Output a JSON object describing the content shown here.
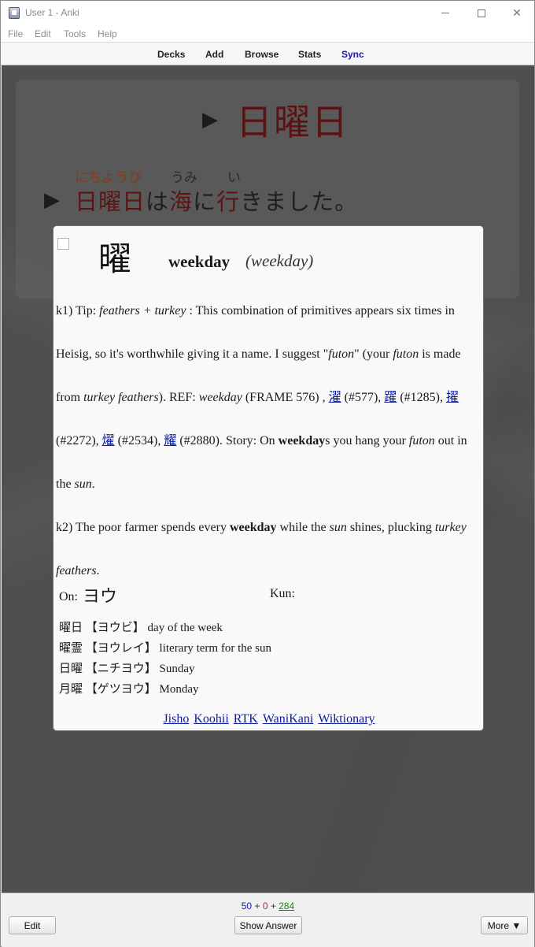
{
  "window": {
    "title": "User 1 - Anki"
  },
  "menu": {
    "items": [
      "File",
      "Edit",
      "Tools",
      "Help"
    ]
  },
  "toolbar": {
    "decks": "Decks",
    "add": "Add",
    "browse": "Browse",
    "stats": "Stats",
    "sync": "Sync"
  },
  "card": {
    "play_icon": "▶",
    "front_word": "日曜日",
    "sentence": {
      "furigana": [
        "にちようび",
        "うみ",
        "い"
      ],
      "parts": [
        "日曜日",
        "は",
        "海",
        "に",
        "行",
        "きました。"
      ]
    }
  },
  "popup": {
    "kanji": "曜",
    "keyword": "weekday",
    "keyword_alt": "(weekday)",
    "story": {
      "k1_label": "k1) Tip: ",
      "k1_prim": "feathers + turkey",
      "k1_t1": " : This combination of primitives appears six times in Heisig, so it's worthwhile giving it a name. I suggest \"",
      "k1_futon": "futon",
      "k1_t2": "\" (your ",
      "k1_futon2": "futon",
      "k1_t3": " is made from ",
      "k1_tf": "turkey feathers",
      "k1_t4": "). REF: ",
      "k1_ref": "weekday",
      "k1_t5": " (FRAME 576) , ",
      "k1_r1k": "濯",
      "k1_r1n": " (#577), ",
      "k1_r2k": "躍",
      "k1_r2n": " (#1285), ",
      "k1_r3k": "擢",
      "k1_r3n": " (#2272), ",
      "k1_r4k": "燿",
      "k1_r4n": " (#2534), ",
      "k1_r5k": "耀",
      "k1_r5n": " (#2880). Story: On ",
      "k1_wd": "weekday",
      "k1_t6": "s you hang your ",
      "k1_futon3": "futon",
      "k1_t7": " out in the ",
      "k1_sun": "sun",
      "k1_t8": ".",
      "k2_label": "k2) The poor farmer spends every ",
      "k2_wd": "weekday",
      "k2_t1": " while the ",
      "k2_sun": "sun",
      "k2_t2": " shines, plucking ",
      "k2_tf": "turkey feathers",
      "k2_t3": "."
    },
    "on_label": "On:",
    "on_value": "ヨウ",
    "kun_label": "Kun:",
    "vocab": [
      {
        "word": "曜日",
        "reading": "【ヨウビ】",
        "meaning": "day of the week"
      },
      {
        "word": "曜霊",
        "reading": "【ヨウレイ】",
        "meaning": "literary term for the sun"
      },
      {
        "word": "日曜",
        "reading": "【ニチヨウ】",
        "meaning": "Sunday"
      },
      {
        "word": "月曜",
        "reading": "【ゲツヨウ】",
        "meaning": "Monday"
      }
    ],
    "links": [
      "Jisho",
      "Koohii",
      "RTK",
      "WaniKani",
      "Wiktionary"
    ]
  },
  "bottom": {
    "count_new": "50",
    "plus": "+",
    "count_learn": "0",
    "count_review": "284",
    "edit": "Edit",
    "show_answer": "Show Answer",
    "more": "More ▼"
  },
  "colors": {
    "new": "#1a1aa0",
    "learn": "#b03020",
    "review": "#1a8a1a",
    "kanji_highlight": "#5a1414"
  }
}
